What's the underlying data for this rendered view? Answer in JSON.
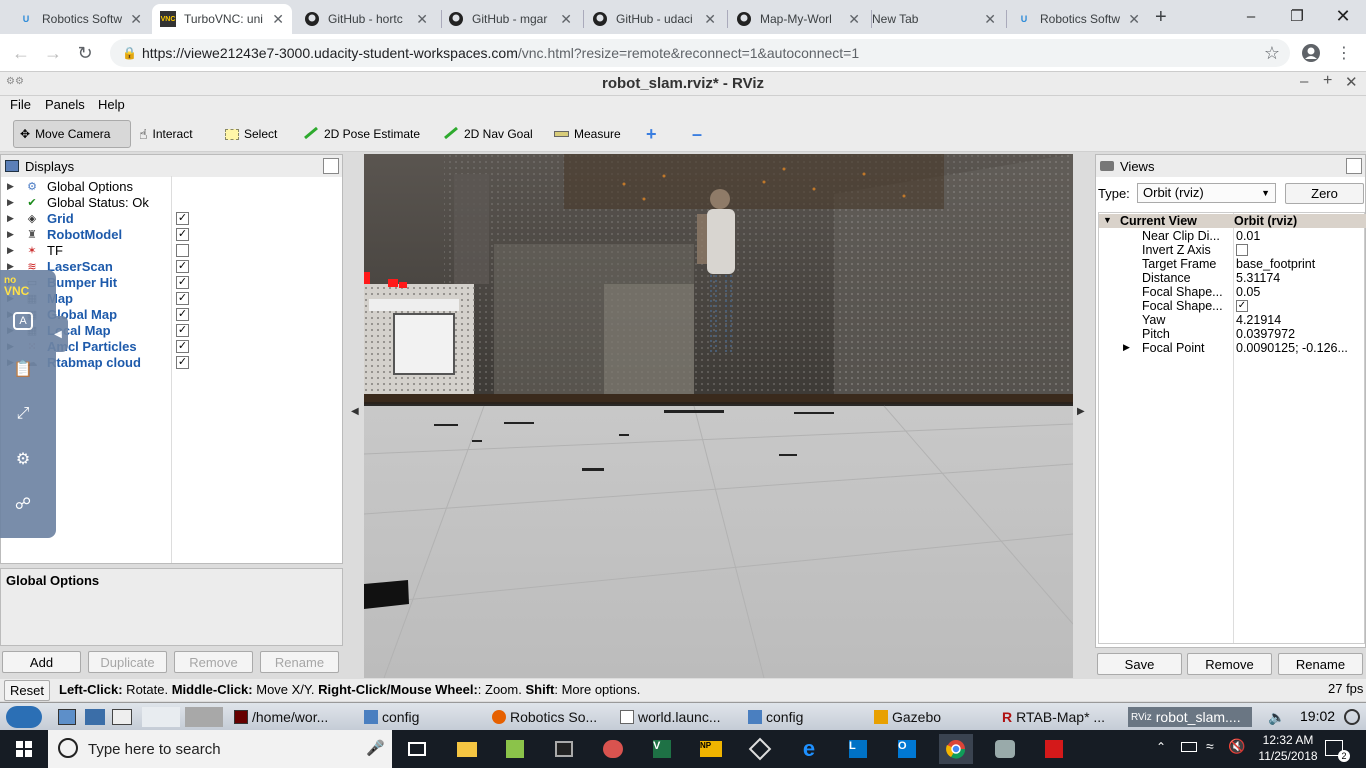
{
  "browser": {
    "tabs": [
      {
        "title": "Robotics Softw",
        "icon": "udacity-icon",
        "active": false
      },
      {
        "title": "TurboVNC: uni",
        "icon": "vnc-icon",
        "active": true
      },
      {
        "title": "GitHub - hortc",
        "icon": "github-icon",
        "active": false
      },
      {
        "title": "GitHub - mgar",
        "icon": "github-icon",
        "active": false
      },
      {
        "title": "GitHub - udaci",
        "icon": "github-icon",
        "active": false
      },
      {
        "title": "Map-My-Worl",
        "icon": "github-icon",
        "active": false
      },
      {
        "title": "New Tab",
        "icon": "",
        "active": false
      },
      {
        "title": "Robotics Softw",
        "icon": "udacity-icon",
        "active": false
      }
    ],
    "url_host": "https://viewe21243e7-3000.udacity-student-workspaces.com",
    "url_path": "/vnc.html?resize=remote&reconnect=1&autoconnect=1"
  },
  "rviz": {
    "window_title": "robot_slam.rviz* - RViz",
    "menu": [
      "File",
      "Panels",
      "Help"
    ],
    "tools": [
      "Move Camera",
      "Interact",
      "Select",
      "2D Pose Estimate",
      "2D Nav Goal",
      "Measure"
    ],
    "displays": {
      "title": "Displays",
      "items": [
        {
          "label": "Global Options",
          "icon": "gear-icon",
          "checked": null,
          "bold": false
        },
        {
          "label": "Global Status: Ok",
          "icon": "checkmark-icon",
          "checked": null,
          "bold": false
        },
        {
          "label": "Grid",
          "icon": "grid-icon",
          "checked": true,
          "bold": true
        },
        {
          "label": "RobotModel",
          "icon": "robot-icon",
          "checked": true,
          "bold": true
        },
        {
          "label": "TF",
          "icon": "tf-icon",
          "checked": false,
          "bold": false
        },
        {
          "label": "LaserScan",
          "icon": "laser-icon",
          "checked": true,
          "bold": true
        },
        {
          "label": "Bumper Hit",
          "icon": "bumper-icon",
          "checked": true,
          "bold": true
        },
        {
          "label": "Map",
          "icon": "map-icon",
          "checked": true,
          "bold": true
        },
        {
          "label": "Global Map",
          "icon": "map-icon",
          "checked": true,
          "bold": true
        },
        {
          "label": "Local Map",
          "icon": "map-icon",
          "checked": true,
          "bold": true
        },
        {
          "label": "Amcl Particles",
          "icon": "particles-icon",
          "checked": true,
          "bold": true
        },
        {
          "label": "Rtabmap cloud",
          "icon": "cloud-icon",
          "checked": true,
          "bold": true
        }
      ],
      "description_title": "Global Options",
      "buttons": {
        "add": "Add",
        "duplicate": "Duplicate",
        "remove": "Remove",
        "rename": "Rename"
      }
    },
    "views": {
      "title": "Views",
      "type_label": "Type:",
      "type_value": "Orbit (rviz)",
      "zero_label": "Zero",
      "current_view_label": "Current View",
      "current_view_value": "Orbit (rviz)",
      "properties": [
        {
          "key": "Near Clip Di...",
          "value": "0.01"
        },
        {
          "key": "Invert Z Axis",
          "value": "",
          "checkbox": false
        },
        {
          "key": "Target Frame",
          "value": "base_footprint"
        },
        {
          "key": "Distance",
          "value": "5.31174"
        },
        {
          "key": "Focal Shape...",
          "value": "0.05"
        },
        {
          "key": "Focal Shape...",
          "value": "",
          "checkbox": true
        },
        {
          "key": "Yaw",
          "value": "4.21914"
        },
        {
          "key": "Pitch",
          "value": "0.0397972"
        },
        {
          "key": "Focal Point",
          "value": "0.0090125; -0.126..."
        }
      ],
      "buttons": {
        "save": "Save",
        "remove": "Remove",
        "rename": "Rename"
      }
    },
    "status": {
      "reset": "Reset",
      "left_click_key": "Left-Click:",
      "left_click_val": " Rotate.",
      "middle_click_key": "Middle-Click:",
      "middle_click_val": " Move X/Y.",
      "right_click_key": "Right-Click/Mouse Wheel:",
      "right_click_val": ": Zoom.",
      "shift_key": "Shift",
      "shift_val": ": More options.",
      "fps": "27 fps"
    }
  },
  "novnc": {
    "logo_top": "no",
    "logo_bottom": "VNC"
  },
  "linux_taskbar": {
    "items": [
      "/home/wor...",
      "config",
      "Robotics So...",
      "world.launc...",
      "config",
      "Gazebo",
      "RTAB-Map* ...",
      "robot_slam...."
    ],
    "clock": "19:02"
  },
  "windows_taskbar": {
    "search_placeholder": "Type here to search",
    "time": "12:32 AM",
    "date": "11/25/2018",
    "notification_count": "2"
  }
}
